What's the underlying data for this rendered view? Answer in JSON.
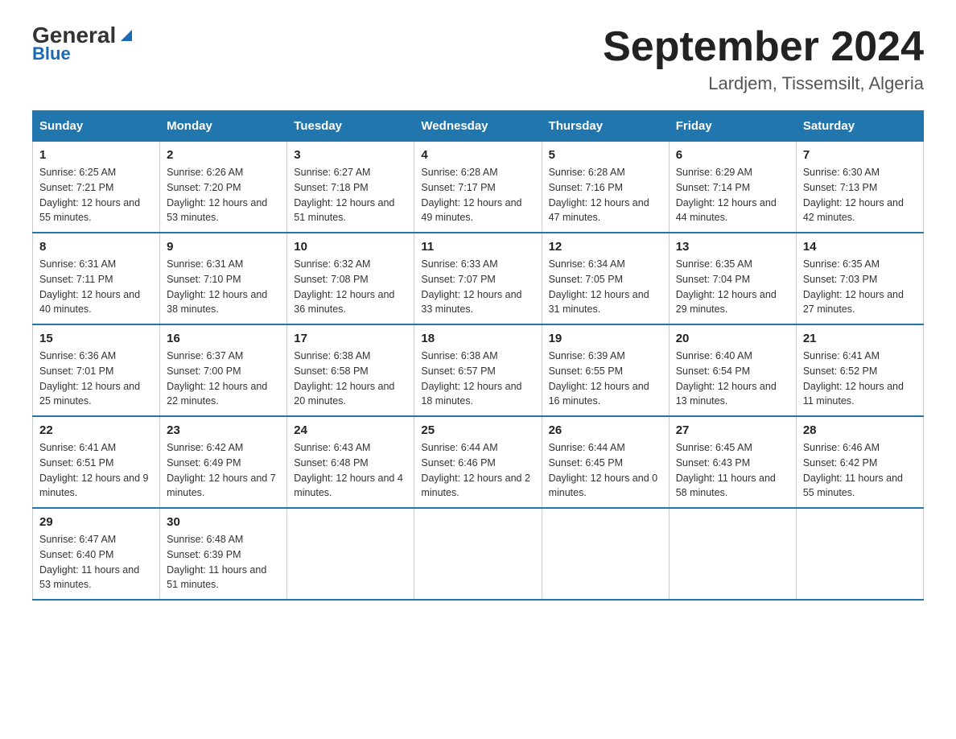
{
  "header": {
    "logo_general": "General",
    "logo_blue": "Blue",
    "month_year": "September 2024",
    "location": "Lardjem, Tissemsilt, Algeria"
  },
  "weekdays": [
    "Sunday",
    "Monday",
    "Tuesday",
    "Wednesday",
    "Thursday",
    "Friday",
    "Saturday"
  ],
  "weeks": [
    [
      {
        "day": "1",
        "sunrise": "6:25 AM",
        "sunset": "7:21 PM",
        "daylight": "12 hours and 55 minutes."
      },
      {
        "day": "2",
        "sunrise": "6:26 AM",
        "sunset": "7:20 PM",
        "daylight": "12 hours and 53 minutes."
      },
      {
        "day": "3",
        "sunrise": "6:27 AM",
        "sunset": "7:18 PM",
        "daylight": "12 hours and 51 minutes."
      },
      {
        "day": "4",
        "sunrise": "6:28 AM",
        "sunset": "7:17 PM",
        "daylight": "12 hours and 49 minutes."
      },
      {
        "day": "5",
        "sunrise": "6:28 AM",
        "sunset": "7:16 PM",
        "daylight": "12 hours and 47 minutes."
      },
      {
        "day": "6",
        "sunrise": "6:29 AM",
        "sunset": "7:14 PM",
        "daylight": "12 hours and 44 minutes."
      },
      {
        "day": "7",
        "sunrise": "6:30 AM",
        "sunset": "7:13 PM",
        "daylight": "12 hours and 42 minutes."
      }
    ],
    [
      {
        "day": "8",
        "sunrise": "6:31 AM",
        "sunset": "7:11 PM",
        "daylight": "12 hours and 40 minutes."
      },
      {
        "day": "9",
        "sunrise": "6:31 AM",
        "sunset": "7:10 PM",
        "daylight": "12 hours and 38 minutes."
      },
      {
        "day": "10",
        "sunrise": "6:32 AM",
        "sunset": "7:08 PM",
        "daylight": "12 hours and 36 minutes."
      },
      {
        "day": "11",
        "sunrise": "6:33 AM",
        "sunset": "7:07 PM",
        "daylight": "12 hours and 33 minutes."
      },
      {
        "day": "12",
        "sunrise": "6:34 AM",
        "sunset": "7:05 PM",
        "daylight": "12 hours and 31 minutes."
      },
      {
        "day": "13",
        "sunrise": "6:35 AM",
        "sunset": "7:04 PM",
        "daylight": "12 hours and 29 minutes."
      },
      {
        "day": "14",
        "sunrise": "6:35 AM",
        "sunset": "7:03 PM",
        "daylight": "12 hours and 27 minutes."
      }
    ],
    [
      {
        "day": "15",
        "sunrise": "6:36 AM",
        "sunset": "7:01 PM",
        "daylight": "12 hours and 25 minutes."
      },
      {
        "day": "16",
        "sunrise": "6:37 AM",
        "sunset": "7:00 PM",
        "daylight": "12 hours and 22 minutes."
      },
      {
        "day": "17",
        "sunrise": "6:38 AM",
        "sunset": "6:58 PM",
        "daylight": "12 hours and 20 minutes."
      },
      {
        "day": "18",
        "sunrise": "6:38 AM",
        "sunset": "6:57 PM",
        "daylight": "12 hours and 18 minutes."
      },
      {
        "day": "19",
        "sunrise": "6:39 AM",
        "sunset": "6:55 PM",
        "daylight": "12 hours and 16 minutes."
      },
      {
        "day": "20",
        "sunrise": "6:40 AM",
        "sunset": "6:54 PM",
        "daylight": "12 hours and 13 minutes."
      },
      {
        "day": "21",
        "sunrise": "6:41 AM",
        "sunset": "6:52 PM",
        "daylight": "12 hours and 11 minutes."
      }
    ],
    [
      {
        "day": "22",
        "sunrise": "6:41 AM",
        "sunset": "6:51 PM",
        "daylight": "12 hours and 9 minutes."
      },
      {
        "day": "23",
        "sunrise": "6:42 AM",
        "sunset": "6:49 PM",
        "daylight": "12 hours and 7 minutes."
      },
      {
        "day": "24",
        "sunrise": "6:43 AM",
        "sunset": "6:48 PM",
        "daylight": "12 hours and 4 minutes."
      },
      {
        "day": "25",
        "sunrise": "6:44 AM",
        "sunset": "6:46 PM",
        "daylight": "12 hours and 2 minutes."
      },
      {
        "day": "26",
        "sunrise": "6:44 AM",
        "sunset": "6:45 PM",
        "daylight": "12 hours and 0 minutes."
      },
      {
        "day": "27",
        "sunrise": "6:45 AM",
        "sunset": "6:43 PM",
        "daylight": "11 hours and 58 minutes."
      },
      {
        "day": "28",
        "sunrise": "6:46 AM",
        "sunset": "6:42 PM",
        "daylight": "11 hours and 55 minutes."
      }
    ],
    [
      {
        "day": "29",
        "sunrise": "6:47 AM",
        "sunset": "6:40 PM",
        "daylight": "11 hours and 53 minutes."
      },
      {
        "day": "30",
        "sunrise": "6:48 AM",
        "sunset": "6:39 PM",
        "daylight": "11 hours and 51 minutes."
      },
      null,
      null,
      null,
      null,
      null
    ]
  ]
}
